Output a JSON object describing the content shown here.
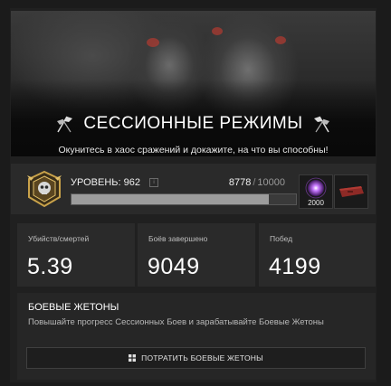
{
  "hero": {
    "title": "СЕССИОННЫЕ РЕЖИМЫ",
    "subtitle": "Окунитесь в хаос сражений и докажите, на что вы способны!"
  },
  "level": {
    "label": "УРОВЕНЬ: 962",
    "info_icon": "i",
    "xp_current": "8778",
    "xp_max": "10000",
    "xp_separator": "/",
    "progress": 0.878
  },
  "rewards": [
    {
      "icon": "purple-orb-icon",
      "count": "2000"
    },
    {
      "icon": "red-crate-icon",
      "count": ""
    }
  ],
  "stats": [
    {
      "label": "Убийств/смертей",
      "value": "5.39"
    },
    {
      "label": "Боёв завершено",
      "value": "9049"
    },
    {
      "label": "Побед",
      "value": "4199"
    }
  ],
  "tokens": {
    "title": "БОЕВЫЕ ЖЕТОНЫ",
    "description": "Повышайте прогресс Сессионных Боев и зарабатывайте Боевые Жетоны",
    "button_label": "ПОТРАТИТЬ БОЕВЫЕ ЖЕТОНЫ"
  },
  "colors": {
    "accent_gold": "#c9a24a",
    "orb_purple": "#9b4bd6",
    "crate_red": "#8e2a26"
  }
}
